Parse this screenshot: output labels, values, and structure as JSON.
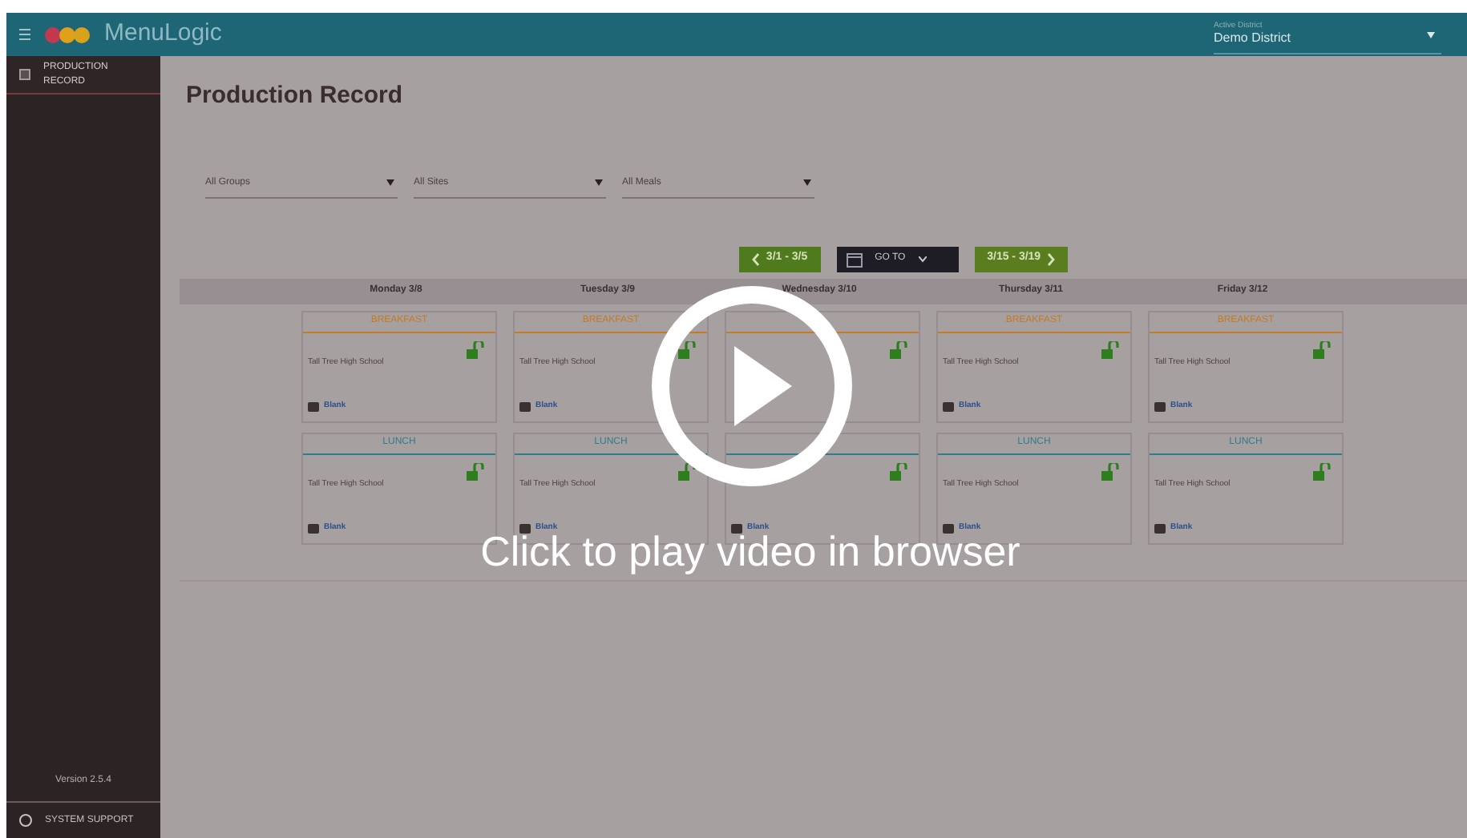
{
  "app": {
    "name": "MenuLogic"
  },
  "district": {
    "label": "Active District",
    "value": "Demo District"
  },
  "sidebar": {
    "items": [
      {
        "label": "PRODUCTION RECORD",
        "selected": true
      }
    ],
    "version": "Version 2.5.4",
    "support": "SYSTEM SUPPORT"
  },
  "page_title": "Production Record",
  "filters": [
    {
      "value": "All Groups"
    },
    {
      "value": "All Sites"
    },
    {
      "value": "All Meals"
    }
  ],
  "nav": {
    "prev": "3/1 - 3/5",
    "goto": "GO TO",
    "next": "3/15 - 3/19"
  },
  "days": [
    {
      "label": "Monday 3/8",
      "meals": [
        {
          "kind": "breakfast",
          "label": "BREAKFAST",
          "site": "Tall Tree High School",
          "status": "Blank"
        },
        {
          "kind": "lunch",
          "label": "LUNCH",
          "site": "Tall Tree High School",
          "status": "Blank"
        }
      ]
    },
    {
      "label": "Tuesday 3/9",
      "meals": [
        {
          "kind": "breakfast",
          "label": "BREAKFAST",
          "site": "Tall Tree High School",
          "status": "Blank"
        },
        {
          "kind": "lunch",
          "label": "LUNCH",
          "site": "Tall Tree High School",
          "status": "Blank"
        }
      ]
    },
    {
      "label": "Wednesday 3/10",
      "meals": [
        {
          "kind": "breakfast"
        },
        {
          "kind": "lunch",
          "status": "Blank"
        }
      ]
    },
    {
      "label": "Thursday 3/11",
      "meals": [
        {
          "kind": "breakfast",
          "label": "BREAKFAST",
          "site": "Tall Tree High School",
          "status": "Blank"
        },
        {
          "kind": "lunch",
          "label": "LUNCH",
          "site": "Tall Tree High School",
          "status": "Blank"
        }
      ]
    },
    {
      "label": "Friday 3/12",
      "meals": [
        {
          "kind": "breakfast",
          "label": "BREAKFAST",
          "site": "Tall Tree High School",
          "status": "Blank"
        },
        {
          "kind": "lunch",
          "label": "LUNCH",
          "site": "Tall Tree High School",
          "status": "Blank"
        }
      ]
    }
  ],
  "video_overlay": {
    "caption": "Click to play video in browser"
  }
}
